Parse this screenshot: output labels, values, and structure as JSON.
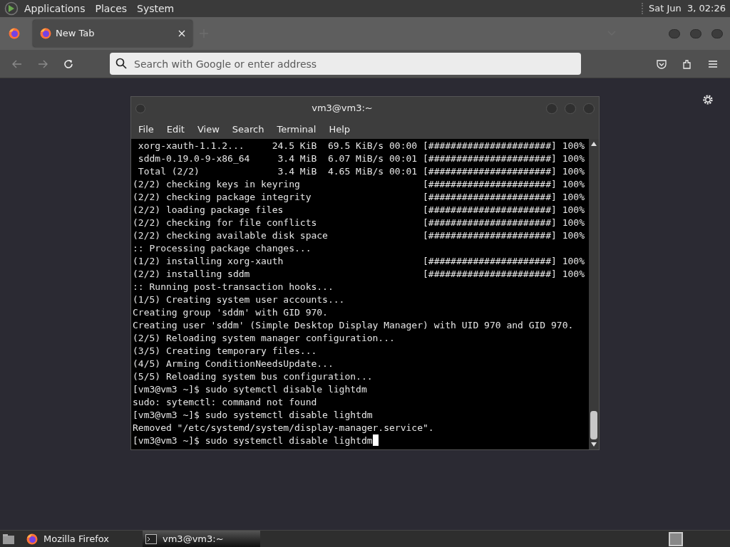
{
  "top_panel": {
    "menus": [
      "Applications",
      "Places",
      "System"
    ],
    "clock": "Sat Jun  3, 02:26"
  },
  "browser": {
    "tabs": [
      {
        "label": "New Tab",
        "selected": true
      }
    ],
    "address_placeholder": "Search with Google or enter address"
  },
  "terminal": {
    "title": "vm3@vm3:~",
    "menu": [
      "File",
      "Edit",
      "View",
      "Search",
      "Terminal",
      "Help"
    ],
    "lines": [
      {
        "text": " xorg-xauth-1.1.2...     24.5 KiB  69.5 KiB/s 00:00",
        "progress": "[######################] 100%"
      },
      {
        "text": " sddm-0.19.0-9-x86_64     3.4 MiB  6.07 MiB/s 00:01",
        "progress": "[######################] 100%"
      },
      {
        "text": " Total (2/2)              3.4 MiB  4.65 MiB/s 00:01",
        "progress": "[######################] 100%"
      },
      {
        "text": "(2/2) checking keys in keyring",
        "progress": "[######################] 100%"
      },
      {
        "text": "(2/2) checking package integrity",
        "progress": "[######################] 100%"
      },
      {
        "text": "(2/2) loading package files",
        "progress": "[######################] 100%"
      },
      {
        "text": "(2/2) checking for file conflicts",
        "progress": "[######################] 100%"
      },
      {
        "text": "(2/2) checking available disk space",
        "progress": "[######################] 100%"
      },
      {
        "text": ":: Processing package changes..."
      },
      {
        "text": "(1/2) installing xorg-xauth",
        "progress": "[######################] 100%"
      },
      {
        "text": "(2/2) installing sddm",
        "progress": "[######################] 100%"
      },
      {
        "text": ":: Running post-transaction hooks..."
      },
      {
        "text": "(1/5) Creating system user accounts..."
      },
      {
        "text": "Creating group 'sddm' with GID 970."
      },
      {
        "text": "Creating user 'sddm' (Simple Desktop Display Manager) with UID 970 and GID 970."
      },
      {
        "text": "(2/5) Reloading system manager configuration..."
      },
      {
        "text": "(3/5) Creating temporary files..."
      },
      {
        "text": "(4/5) Arming ConditionNeedsUpdate..."
      },
      {
        "text": "(5/5) Reloading system bus configuration..."
      },
      {
        "text": "[vm3@vm3 ~]$ sudo sytemctl disable lightdm"
      },
      {
        "text": "sudo: sytemctl: command not found"
      },
      {
        "text": "[vm3@vm3 ~]$ sudo systemctl disable lightdm"
      },
      {
        "text": "Removed \"/etc/systemd/system/display-manager.service\"."
      },
      {
        "text": "[vm3@vm3 ~]$ sudo systemctl disable lightdm",
        "cursor": true
      }
    ]
  },
  "taskbar": {
    "items": [
      {
        "kind": "firefox",
        "label": "Mozilla Firefox",
        "selected": false
      },
      {
        "kind": "terminal",
        "label": "vm3@vm3:~",
        "selected": true
      }
    ]
  }
}
